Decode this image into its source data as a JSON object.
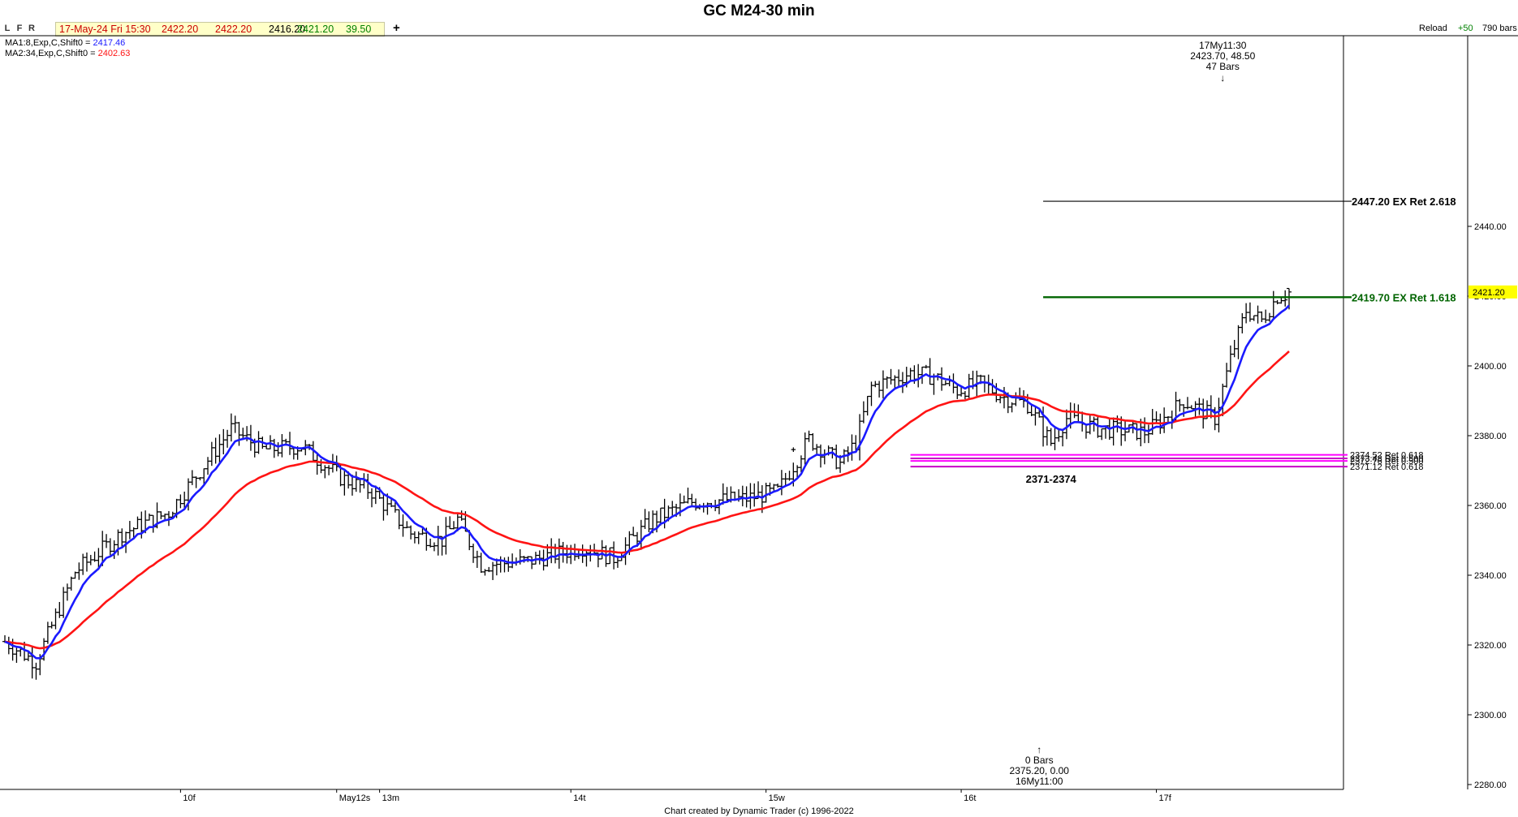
{
  "window": {
    "title": "GC M24-30 min"
  },
  "toolbar": {
    "buttons": [
      "L",
      "F",
      "R"
    ],
    "ohlc": {
      "date": "17-May-24 Fri 15:30",
      "open": "2422.20",
      "high": "2422.20",
      "low": "2416.20",
      "close": "2421.20",
      "change": "39.50"
    },
    "plus": "+",
    "reload": "Reload",
    "reload_step": "+50",
    "bars": "790 bars"
  },
  "legend": {
    "ma1_label": "MA1:8,Exp,C,Shift0 = ",
    "ma1_value": "2417.46",
    "ma2_label": "MA2:34,Exp,C,Shift0 = ",
    "ma2_value": "2402.63"
  },
  "colors": {
    "ma1": "#1a1aff",
    "ma2": "#ff1414",
    "ret_1618": "#006400",
    "cluster": "#ff00ff",
    "cluster_alt": "#c800c8",
    "price_tag": "#ffff00",
    "ohlc_open": "#cc0000",
    "ohlc_close": "#008000"
  },
  "footer": {
    "credit": "Chart created by Dynamic Trader  (c) 1996-2022"
  },
  "chart_data": {
    "type": "ohlc",
    "title": "GC M24-30 min",
    "ylim": [
      2280,
      2500
    ],
    "y_ticks": [
      2280,
      2300,
      2320,
      2340,
      2360,
      2380,
      2400,
      2420,
      2440
    ],
    "y_tick_labels": [
      "2280.00",
      "2300.00",
      "2320.00",
      "2340.00",
      "2360.00",
      "2380.00",
      "2400.00",
      "2420.00",
      "2440.00"
    ],
    "x_labels": [
      {
        "label": "10f",
        "bar": 45
      },
      {
        "label": "May12s",
        "bar": 85
      },
      {
        "label": "13m",
        "bar": 96
      },
      {
        "label": "14t",
        "bar": 145
      },
      {
        "label": "15w",
        "bar": 195
      },
      {
        "label": "16t",
        "bar": 245
      },
      {
        "label": "17f",
        "bar": 295
      }
    ],
    "last_price": "2421.20",
    "bar_count": 330,
    "price_path": [
      [
        0,
        2321
      ],
      [
        8,
        2315
      ],
      [
        18,
        2341
      ],
      [
        30,
        2352
      ],
      [
        42,
        2358
      ],
      [
        52,
        2373
      ],
      [
        58,
        2382
      ],
      [
        66,
        2376
      ],
      [
        76,
        2377
      ],
      [
        86,
        2368
      ],
      [
        94,
        2364
      ],
      [
        104,
        2352
      ],
      [
        112,
        2350
      ],
      [
        116,
        2356
      ],
      [
        122,
        2343
      ],
      [
        134,
        2344
      ],
      [
        148,
        2348
      ],
      [
        156,
        2345
      ],
      [
        166,
        2356
      ],
      [
        176,
        2361
      ],
      [
        190,
        2362
      ],
      [
        198,
        2364
      ],
      [
        206,
        2379
      ],
      [
        214,
        2372
      ],
      [
        218,
        2378
      ],
      [
        222,
        2394
      ],
      [
        232,
        2398
      ],
      [
        238,
        2397
      ],
      [
        244,
        2393
      ],
      [
        250,
        2395
      ],
      [
        256,
        2391
      ],
      [
        262,
        2389
      ],
      [
        268,
        2378
      ],
      [
        272,
        2385
      ],
      [
        280,
        2382
      ],
      [
        292,
        2381
      ],
      [
        296,
        2384
      ],
      [
        302,
        2390
      ],
      [
        310,
        2385
      ],
      [
        314,
        2402
      ],
      [
        318,
        2416
      ],
      [
        322,
        2413
      ],
      [
        326,
        2420
      ],
      [
        330,
        2421
      ]
    ],
    "series": [
      {
        "name": "MA1:8,Exp,C,Shift0",
        "last": 2417.46
      },
      {
        "name": "MA2:34,Exp,C,Shift0",
        "last": 2402.63
      }
    ],
    "levels": [
      {
        "value": 2447.2,
        "label": "2447.20 EX Ret 2.618",
        "color": "#000000",
        "from_bar": 266
      },
      {
        "value": 2419.7,
        "label": "2419.70 EX Ret 1.618",
        "color": "#006400",
        "from_bar": 266
      }
    ],
    "cluster": {
      "label": "2371-2374",
      "lines": [
        {
          "value": 2374.52,
          "label": "2374.52 Ret 0.618"
        },
        {
          "value": 2373.48,
          "label": "2373.48 Ret 0.500"
        },
        {
          "value": 2372.76,
          "label": "2372.76 Ret 0.500"
        },
        {
          "value": 2371.12,
          "label": "2371.12 Ret 0.618"
        }
      ],
      "from_bar": 232
    },
    "annotations": [
      {
        "lines": [
          "17My11:30",
          "2423.70, 48.50",
          "47 Bars"
        ],
        "bar": 312,
        "arrow": "↓"
      },
      {
        "lines": [
          "0 Bars",
          "2375.20, 0.00",
          "16My11:00"
        ],
        "bar": 265,
        "arrow": "↑"
      }
    ],
    "marker": {
      "symbol": "+",
      "bar": 202,
      "value": 2376
    }
  }
}
